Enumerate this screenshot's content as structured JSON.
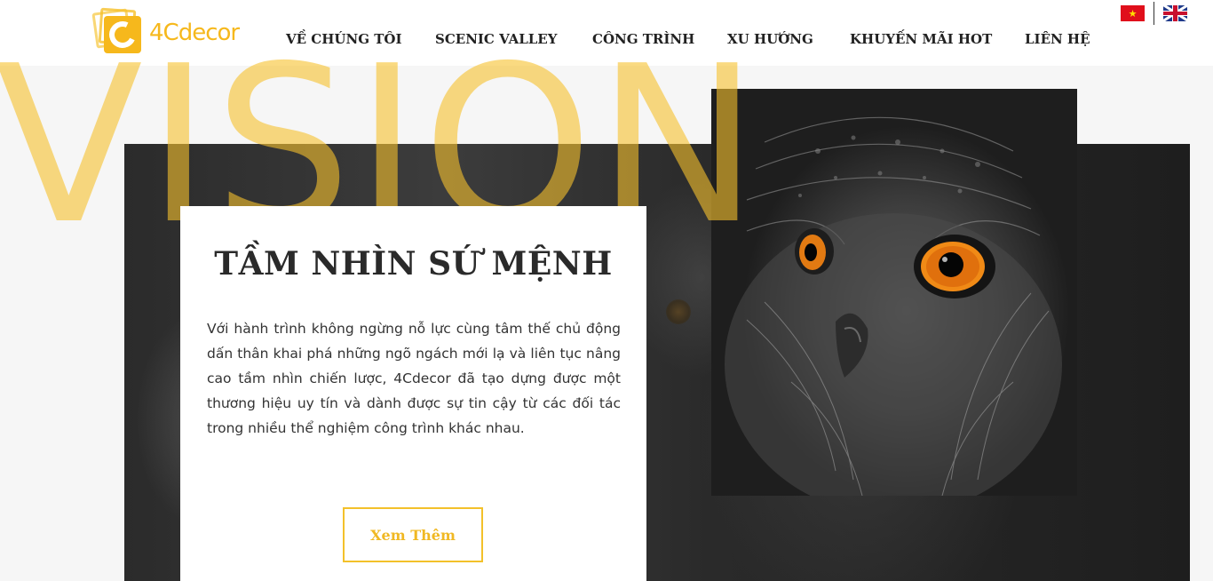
{
  "brand": {
    "name": "4Cdecor",
    "accent_color": "#f6b81c"
  },
  "nav": {
    "items": [
      {
        "label": "VỀ CHÚNG TÔI",
        "active": true
      },
      {
        "label": "SCENIC VALLEY",
        "active": false
      },
      {
        "label": "CÔNG TRÌNH",
        "active": false
      },
      {
        "label": "XU HƯỚNG",
        "active": false
      },
      {
        "label": "KHUYẾN MÃI HOT",
        "active": false
      },
      {
        "label": "LIÊN HỆ",
        "active": false
      }
    ]
  },
  "languages": [
    {
      "icon": "vietnam-flag-icon"
    },
    {
      "icon": "uk-flag-icon"
    }
  ],
  "hero": {
    "watermark": "VISION",
    "title": "TẦM NHÌN SỨ MỆNH",
    "body": "Với hành trình không ngừng nỗ lực cùng tâm thế chủ động dấn thân khai phá những ngõ ngách mới lạ và liên tục nâng cao tầm nhìn chiến lược, 4Cdecor đã tạo dựng được một thương hiệu uy tín và dành được sự tin cậy từ các đối tác trong nhiều thể nghiệm công trình khác nhau.",
    "button_label": "Xem Thêm",
    "image": "owl-photo"
  }
}
